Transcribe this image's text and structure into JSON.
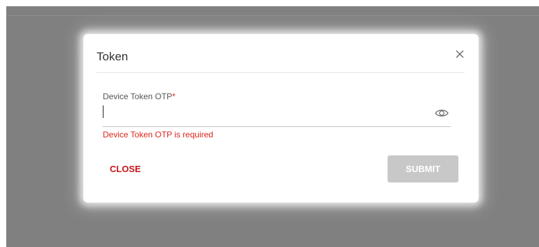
{
  "dialog": {
    "title": "Token",
    "field": {
      "label": "Device Token OTP",
      "required_mark": "*",
      "value": "",
      "error": "Device Token OTP is required"
    },
    "actions": {
      "close_label": "CLOSE",
      "submit_label": "SUBMIT"
    }
  },
  "icons": {
    "close": "close-icon",
    "toggle_visibility": "eye-icon"
  },
  "colors": {
    "accent_red": "#c8141c",
    "error_red": "#d9241b",
    "overlay": "#808080",
    "submit_disabled": "#c8c8c8"
  }
}
